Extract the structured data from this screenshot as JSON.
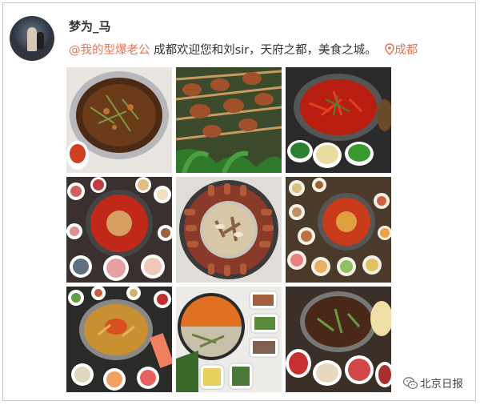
{
  "post": {
    "username": "梦为_马",
    "mention": "@我的型爆老公",
    "text": " 成都欢迎您和刘sir，天府之都，美食之城。",
    "location_label": "成都"
  },
  "photos": [
    {
      "subject": "hot-pot-broth"
    },
    {
      "subject": "skewers-vegetables"
    },
    {
      "subject": "red-chili-hot-pot"
    },
    {
      "subject": "hot-pot-table-spread"
    },
    {
      "subject": "mandarin-duck-pot"
    },
    {
      "subject": "multi-dish-hot-pot"
    },
    {
      "subject": "yellow-broth-hot-pot"
    },
    {
      "subject": "split-hot-pot"
    },
    {
      "subject": "hot-pot-with-meats"
    }
  ],
  "watermark": {
    "text": "北京日报"
  },
  "colors": {
    "accent": "#eb7350",
    "text": "#333333"
  }
}
